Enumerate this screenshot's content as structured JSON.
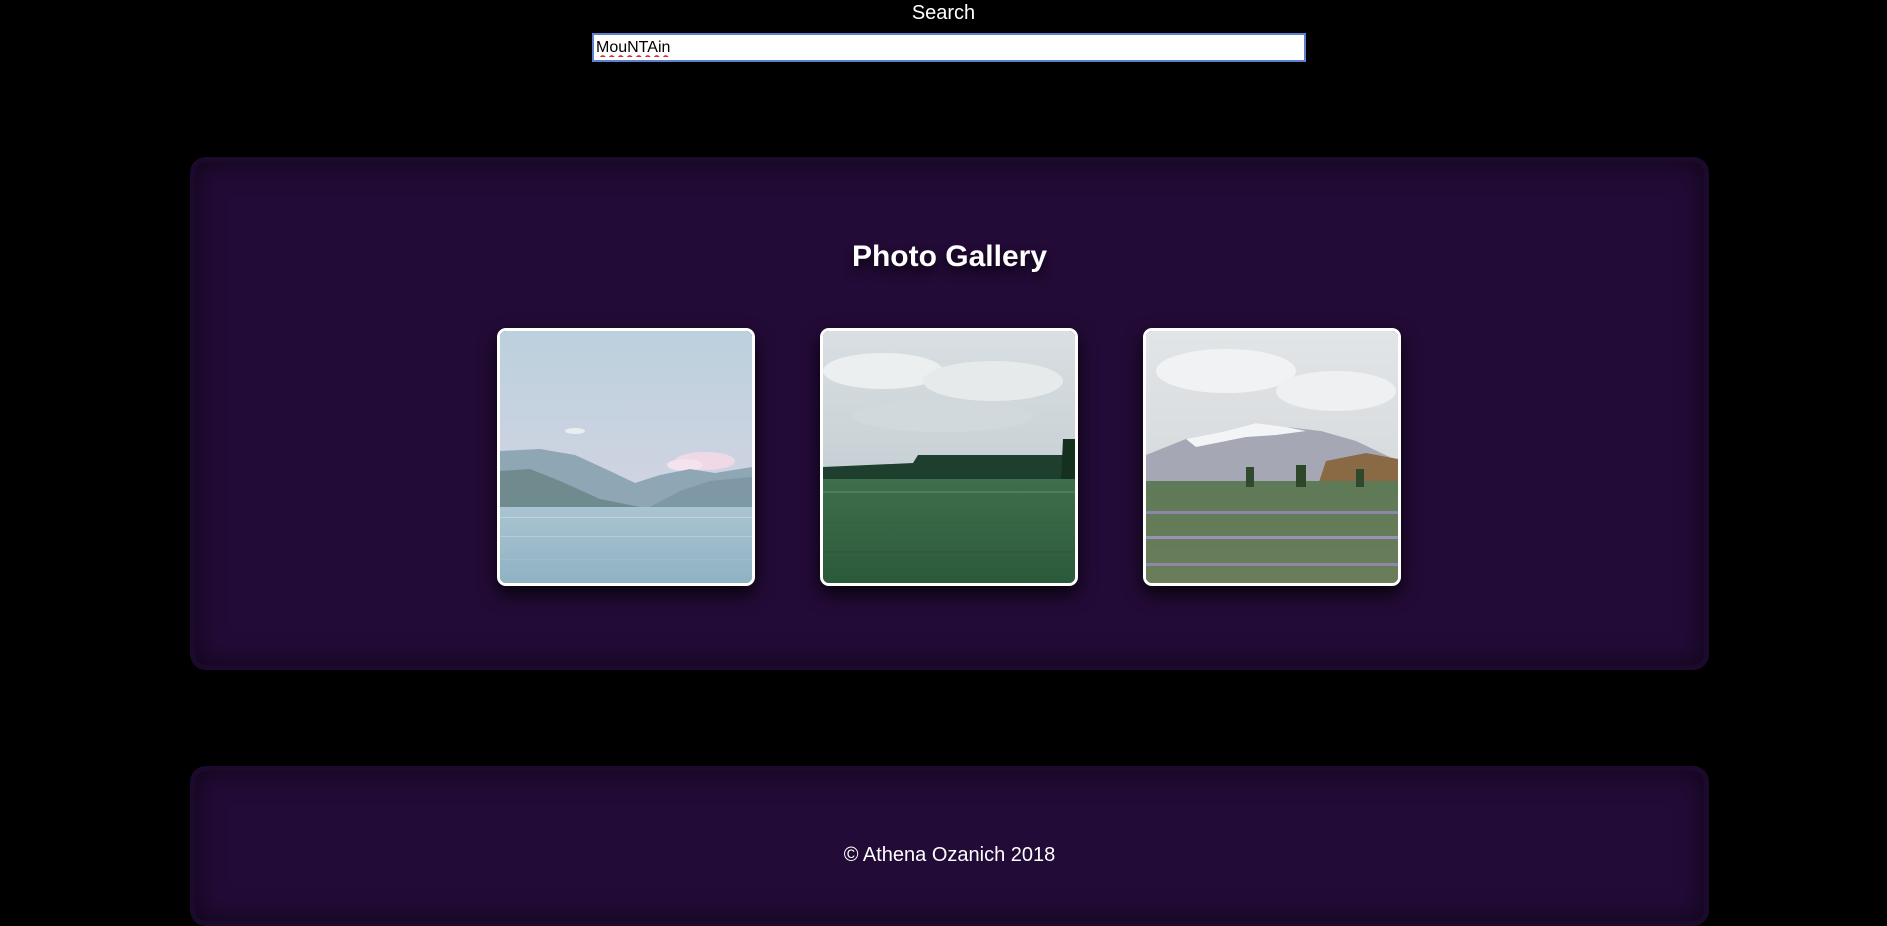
{
  "search": {
    "label": "Search",
    "value": "MouNTAin"
  },
  "gallery": {
    "title": "Photo Gallery",
    "photos": [
      {
        "scene": "lake-with-mountains"
      },
      {
        "scene": "green-field-with-distant-hills"
      },
      {
        "scene": "snowy-mountain-with-lupine-meadow"
      }
    ]
  },
  "footer": {
    "text": "© Athena Ozanich 2018"
  },
  "colors": {
    "page_background": "#000000",
    "panel_background": "#230b37",
    "panel_border": "#1c0a2c",
    "input_border": "#5b7fd1",
    "photo_border": "#ffffff"
  }
}
